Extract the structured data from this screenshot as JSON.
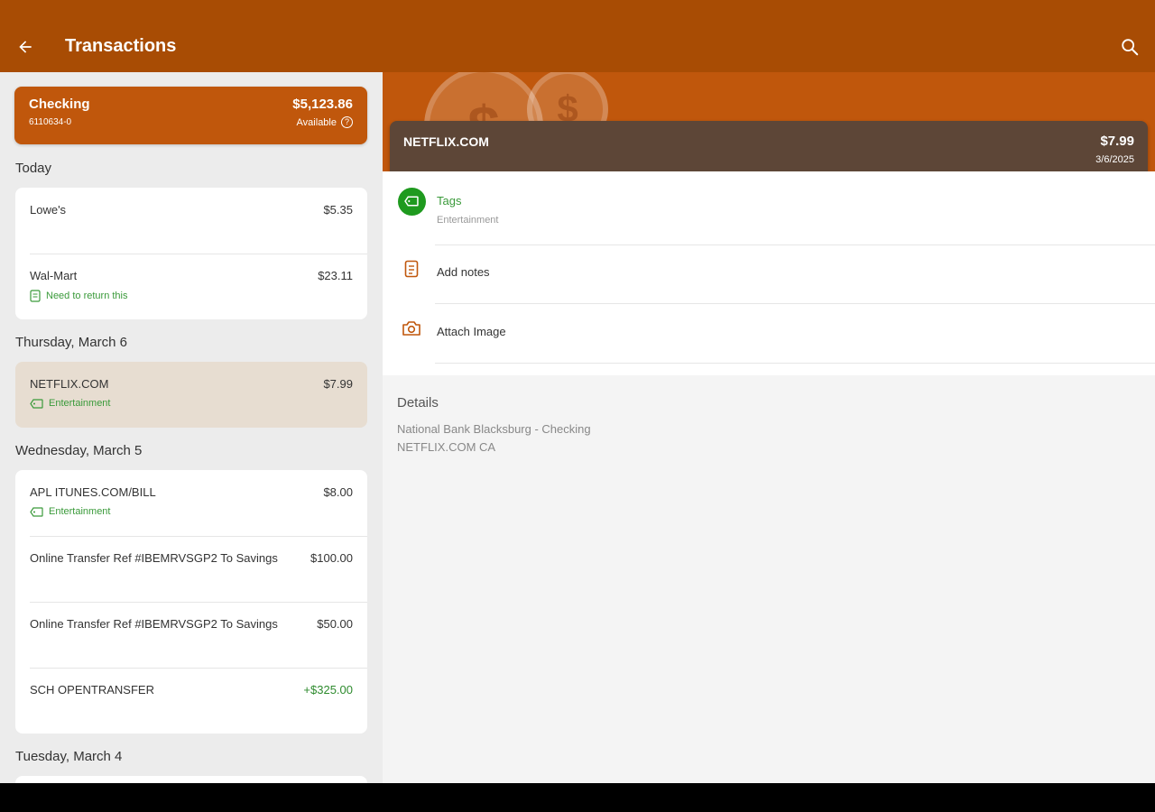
{
  "topbar": {
    "title": "Transactions",
    "back_icon": "arrow-left-icon",
    "search_icon": "search-icon"
  },
  "account": {
    "name": "Checking",
    "number": "6110634-0",
    "balance": "$5,123.86",
    "available_label": "Available"
  },
  "sections": [
    {
      "heading": "Today",
      "transactions": [
        {
          "name": "Lowe's",
          "amount": "$5.35",
          "sub": ""
        },
        {
          "name": "Wal-Mart",
          "amount": "$23.11",
          "sub": "Need to return this",
          "sub_icon": "note-icon"
        }
      ]
    },
    {
      "heading": "Thursday, March 6",
      "transactions": [
        {
          "name": "NETFLIX.COM",
          "amount": "$7.99",
          "sub": "Entertainment",
          "sub_icon": "tag-icon",
          "selected": true
        }
      ]
    },
    {
      "heading": "Wednesday, March 5",
      "transactions": [
        {
          "name": "APL ITUNES.COM/BILL",
          "amount": "$8.00",
          "sub": "Entertainment",
          "sub_icon": "tag-icon"
        },
        {
          "name": "Online Transfer Ref #IBEMRVSGP2 To Savings",
          "amount": "$100.00",
          "sub": ""
        },
        {
          "name": "Online Transfer Ref #IBEMRVSGP2 To Savings",
          "amount": "$50.00",
          "sub": ""
        },
        {
          "name": "SCH OPENTRANSFER",
          "amount": "+$325.00",
          "sub": "",
          "positive": true
        }
      ]
    },
    {
      "heading": "Tuesday, March 4",
      "transactions": []
    }
  ],
  "detail": {
    "name": "NETFLIX.COM",
    "amount": "$7.99",
    "date": "3/6/2025",
    "tags_label": "Tags",
    "tags_value": "Entertainment",
    "notes_label": "Add notes",
    "image_label": "Attach Image",
    "details_heading": "Details",
    "details_lines": [
      "National Bank Blacksburg - Checking",
      "NETFLIX.COM CA"
    ]
  },
  "colors": {
    "topbar": "#a84c04",
    "accent": "#c0570c",
    "detail_header": "#5d4637",
    "tag_green": "#1f9a1f",
    "positive": "#2e8b2e"
  }
}
